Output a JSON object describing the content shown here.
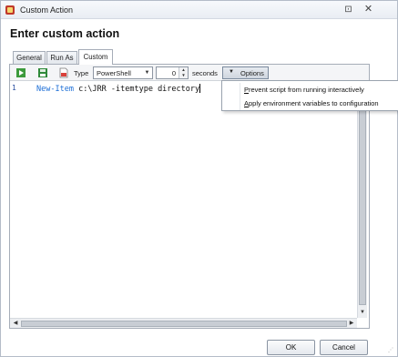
{
  "window": {
    "title": "Custom Action",
    "pin_glyph": "⊡",
    "close_glyph": "✕"
  },
  "heading": "Enter custom action",
  "tabs": [
    {
      "label": "General"
    },
    {
      "label": "Run As"
    },
    {
      "label": "Custom",
      "active": true
    }
  ],
  "toolbar": {
    "icons": [
      "run-script-icon",
      "save-icon",
      "open-file-icon"
    ],
    "type_label": "Type",
    "type_value": "PowerShell",
    "timeout_value": "0",
    "seconds_label": "seconds",
    "options_label": "Options"
  },
  "editor": {
    "line_number": "1",
    "keyword": "New-Item",
    "rest": " c:\\JRR -itemtype directory"
  },
  "options_menu": {
    "items": [
      {
        "label": "Prevent script from running interactively",
        "mnemonic": "P"
      },
      {
        "label": "Apply environment variables to configuration",
        "mnemonic": "A"
      }
    ]
  },
  "footer": {
    "ok_label": "OK",
    "cancel_label": "Cancel"
  },
  "colors": {
    "keyword": "#1c6ed6",
    "line_number": "#2a4fa0"
  }
}
